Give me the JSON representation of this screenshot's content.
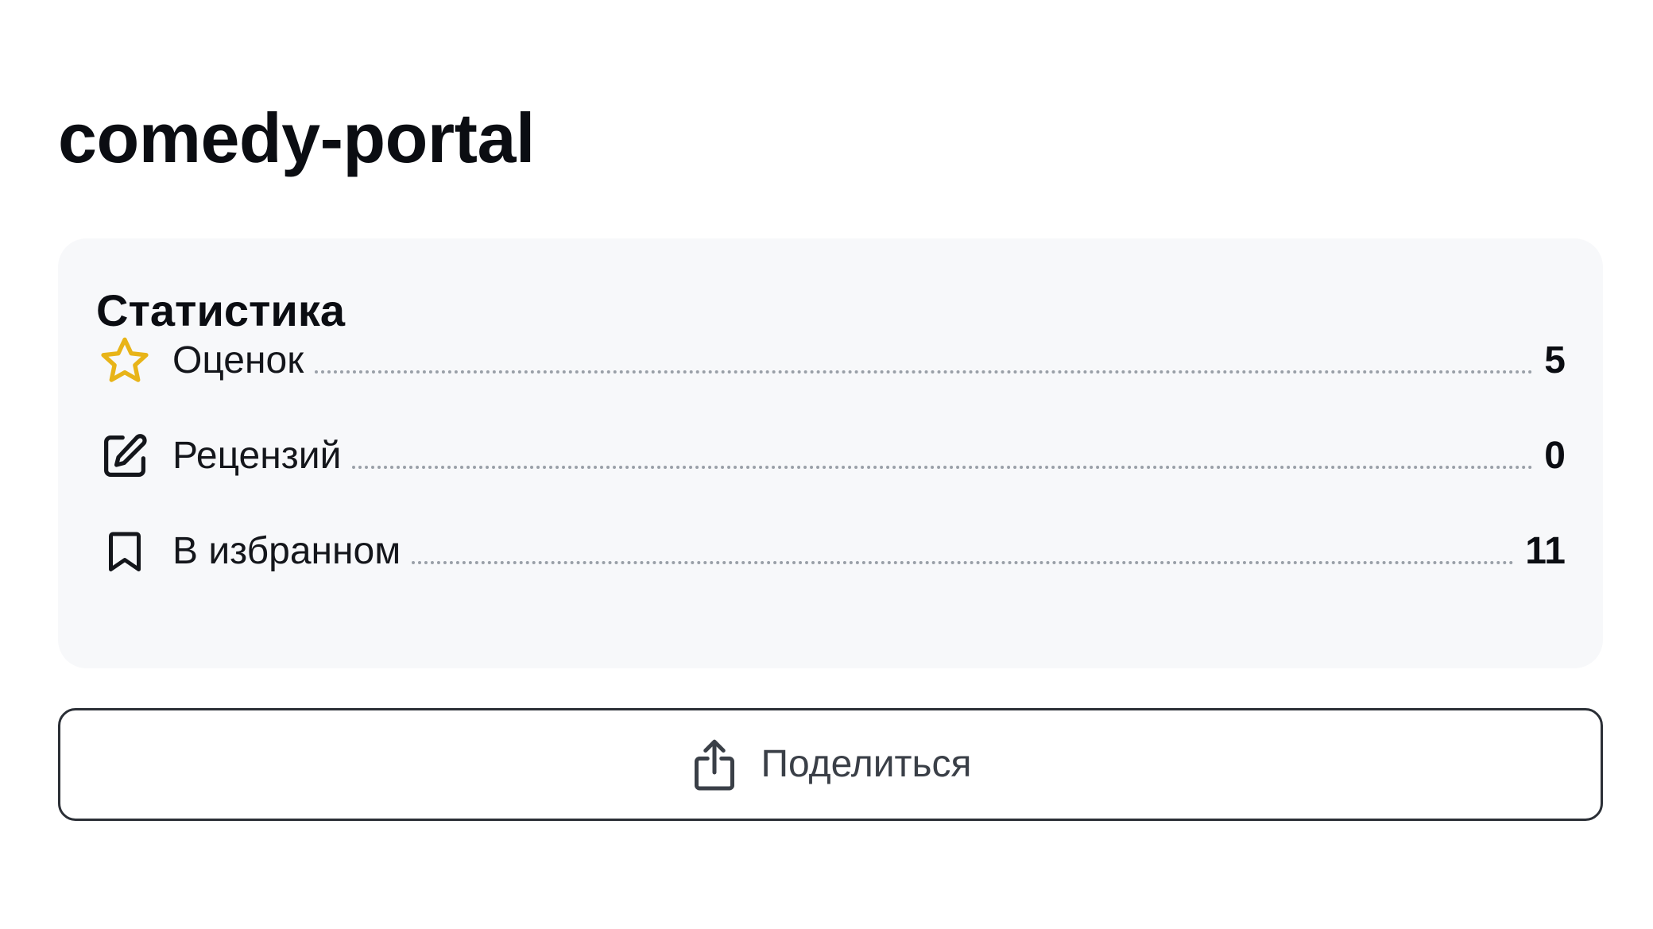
{
  "page": {
    "title": "comedy-portal"
  },
  "statistics": {
    "title": "Статистика",
    "items": [
      {
        "icon": "star-icon",
        "label": "Оценок",
        "value": "5"
      },
      {
        "icon": "edit-icon",
        "label": "Рецензий",
        "value": "0"
      },
      {
        "icon": "bookmark-icon",
        "label": "В избранном",
        "value": "11"
      }
    ]
  },
  "share_button": {
    "icon": "share-icon",
    "label": "Поделиться"
  },
  "colors": {
    "star_accent": "#e8b418",
    "card_background": "#f7f8fa",
    "text_primary": "#0b0d12"
  }
}
